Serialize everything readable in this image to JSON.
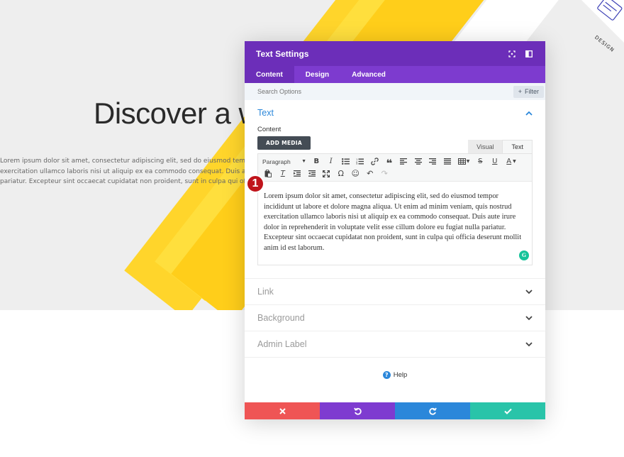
{
  "hero": {
    "title": "Discover a w",
    "paragraph_lines": [
      "Lorem ipsum dolor sit amet, consectetur adipiscing elit, sed do eiusmod tempor incidid",
      "exercitation ullamco laboris nisi ut aliquip ex ea commodo consequat. Duis aute irure d",
      "pariatur. Excepteur sint occaecat cupidatat non proident, sunt in culpa qui officia dese"
    ],
    "design_label": "DESIGN"
  },
  "modal": {
    "title": "Text Settings",
    "tabs": [
      "Content",
      "Design",
      "Advanced"
    ],
    "active_tab": "Content",
    "search_placeholder": "Search Options",
    "filter_label": "Filter",
    "text_section": {
      "title": "Text",
      "content_label": "Content",
      "add_media_label": "ADD MEDIA",
      "view_tabs": [
        "Visual",
        "Text"
      ],
      "active_view": "Text",
      "format_select": "Paragraph",
      "body": "Lorem ipsum dolor sit amet, consectetur adipiscing elit, sed do eiusmod tempor incididunt ut labore et dolore magna aliqua. Ut enim ad minim veniam, quis nostrud exercitation ullamco laboris nisi ut aliquip ex ea commodo consequat. Duis aute irure dolor in reprehenderit in voluptate velit esse cillum dolore eu fugiat nulla pariatur. Excepteur sint occaecat cupidatat non proident, sunt in culpa qui officia deserunt mollit anim id est laborum."
    },
    "collapsed_sections": [
      "Link",
      "Background",
      "Admin Label"
    ],
    "help_label": "Help",
    "step_badge": "1"
  },
  "colors": {
    "header_purple": "#6c2eb9",
    "tab_purple": "#7d3bcf",
    "accent_blue": "#2b87da",
    "cancel_red": "#ef5555",
    "undo_purple": "#7e3bd0",
    "redo_blue": "#2b87da",
    "save_green": "#29c4a9",
    "badge_red": "#c0141b",
    "stripe_yellow": "#ffd52b"
  }
}
